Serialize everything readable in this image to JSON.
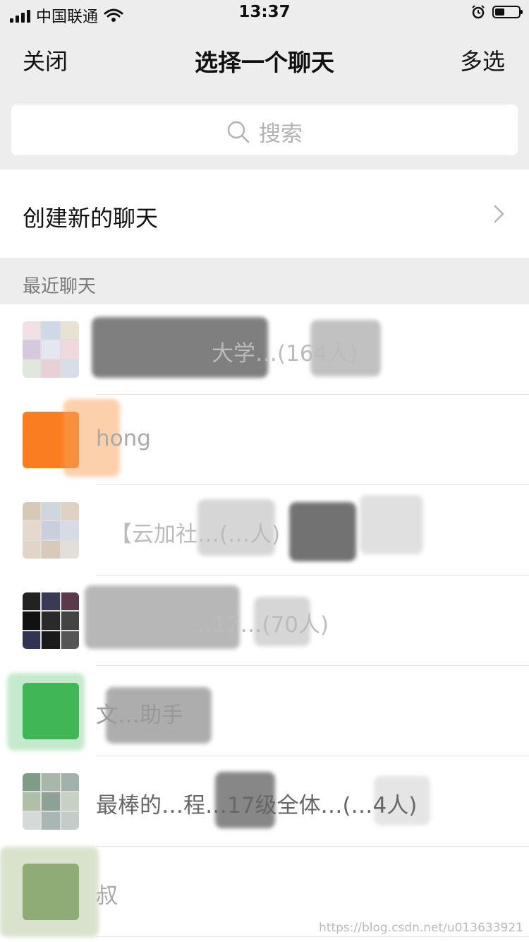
{
  "status_bar": {
    "carrier": "中国联通",
    "time": "13:37",
    "battery_level": 0.4
  },
  "nav": {
    "close": "关闭",
    "title": "选择一个聊天",
    "multi_select": "多选"
  },
  "search": {
    "placeholder": "搜索"
  },
  "create_new_chat": "创建新的聊天",
  "recent_header": "最近聊天",
  "chats": [
    {
      "name": "大学…(164人)",
      "avatar_color": "#e9dede"
    },
    {
      "name": "hong",
      "avatar_color": "#fa7d20"
    },
    {
      "name": "【云加社…(…人)",
      "avatar_color": "#d9c4b0"
    },
    {
      "name": "…17…(70人)",
      "avatar_color": "#2b2b3a"
    },
    {
      "name": "文…助手",
      "avatar_color": "#31b04a"
    },
    {
      "name": "最棒的…程…17级全体…(…4人)",
      "avatar_color": "#8aa69a"
    },
    {
      "name": "叔",
      "avatar_color": "#7a9a62"
    }
  ],
  "watermark": "https://blog.csdn.net/u013633921"
}
